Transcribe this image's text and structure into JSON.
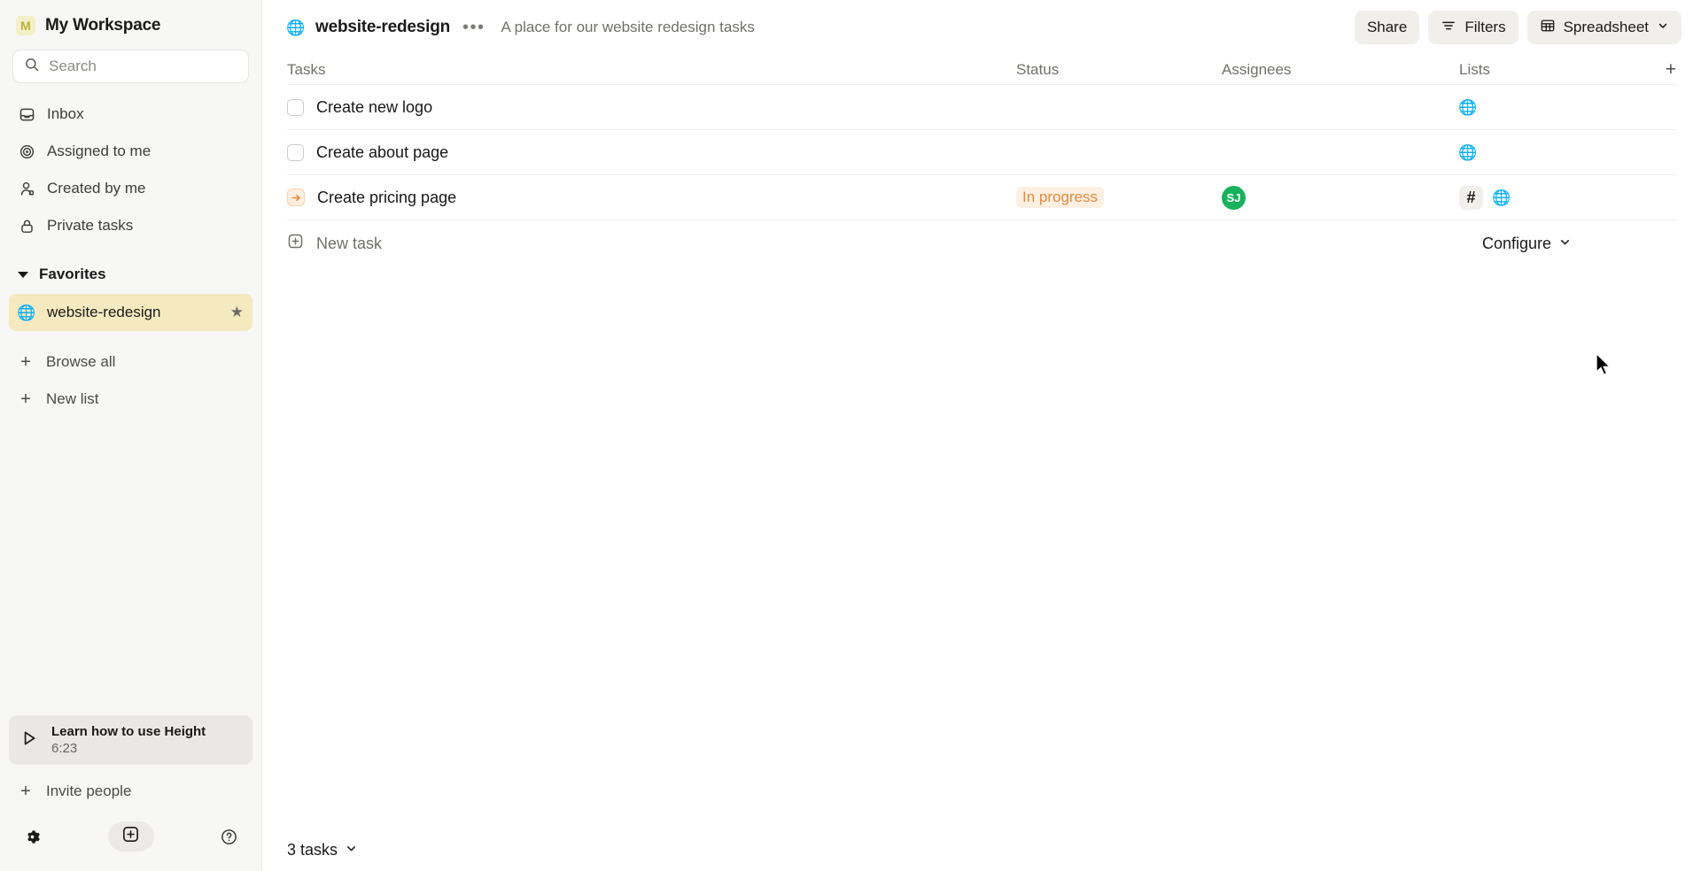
{
  "sidebar": {
    "workspace": {
      "initial": "M",
      "name": "My Workspace"
    },
    "search": {
      "placeholder": "Search",
      "icon": "search-icon"
    },
    "nav_items": [
      {
        "label": "Inbox",
        "icon": "inbox-icon"
      },
      {
        "label": "Assigned to me",
        "icon": "target-icon"
      },
      {
        "label": "Created by me",
        "icon": "user-icon"
      },
      {
        "label": "Private tasks",
        "icon": "lock-icon"
      }
    ],
    "favorites": {
      "section_label": "Favorites",
      "items": [
        {
          "label": "website-redesign",
          "icon": "globe-money-icon",
          "starred": true,
          "star_icon": "star-filled-icon",
          "active": true
        }
      ]
    },
    "actions": [
      {
        "label": "Browse all",
        "icon": "plus-icon"
      },
      {
        "label": "New list",
        "icon": "plus-icon"
      }
    ],
    "learn_card": {
      "title": "Learn how to use Height",
      "duration": "6:23",
      "icon": "play-icon"
    },
    "invite": {
      "label": "Invite people",
      "icon": "plus-icon"
    },
    "footer": {
      "settings_icon": "gear-icon",
      "new_icon": "plus-square-icon",
      "help_icon": "question-circle-icon"
    }
  },
  "header": {
    "list_icon": "globe-money-icon",
    "title": "website-redesign",
    "more_icon": "ellipsis-icon",
    "description": "A place for our website redesign tasks",
    "buttons": [
      {
        "label": "Share",
        "name": "share-button"
      },
      {
        "label": "Filters",
        "name": "filters-button",
        "icon": "filter-icon"
      },
      {
        "label": "Spreadsheet",
        "name": "view-switcher-button",
        "icon": "spreadsheet-icon",
        "chevron": "chevron-down-icon"
      }
    ]
  },
  "table": {
    "columns": {
      "tasks": "Tasks",
      "status": "Status",
      "assignees": "Assignees",
      "lists": "Lists",
      "add": "+"
    },
    "rows": [
      {
        "title": "Create new logo",
        "leading_icon": "checkbox",
        "status": "",
        "assignees": [],
        "lists": [
          {
            "type": "emoji",
            "icon": "globe-money-icon"
          }
        ]
      },
      {
        "title": "Create about page",
        "leading_icon": "checkbox",
        "status": "",
        "assignees": [],
        "lists": [
          {
            "type": "emoji",
            "icon": "globe-money-icon"
          }
        ]
      },
      {
        "title": "Create pricing page",
        "leading_icon": "in-progress-icon",
        "status": "In progress",
        "assignees": [
          {
            "initials": "SJ",
            "color": "#18b15c"
          }
        ],
        "lists": [
          {
            "type": "hash",
            "label": "#"
          },
          {
            "type": "emoji",
            "icon": "globe-money-icon"
          }
        ]
      }
    ],
    "new_task": {
      "label": "New task",
      "icon": "plus-square-icon"
    },
    "configure": {
      "label": "Configure",
      "chevron": "chevron-down-icon"
    }
  },
  "footer": {
    "task_count": "3 tasks",
    "chevron": "chevron-down-icon"
  },
  "colors": {
    "accent_yellow": "#f5e9c0",
    "status_orange": "#e2893c",
    "avatar_green": "#18b15c",
    "sidebar_bg": "#f7f7f6"
  }
}
